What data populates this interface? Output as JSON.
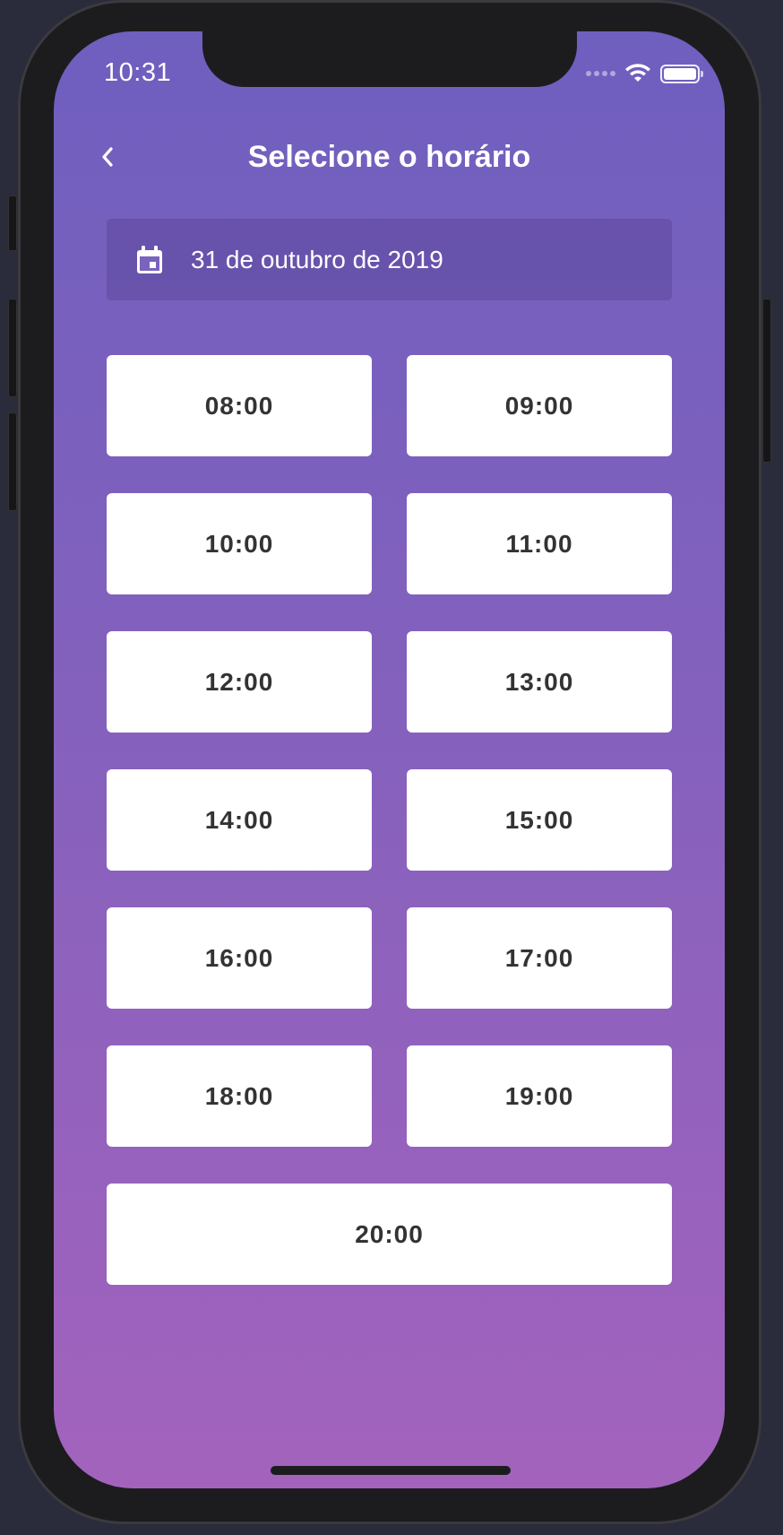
{
  "status_bar": {
    "time": "10:31"
  },
  "header": {
    "title": "Selecione o horário"
  },
  "date_selector": {
    "label": "31 de outubro de 2019"
  },
  "time_slots": [
    "08:00",
    "09:00",
    "10:00",
    "11:00",
    "12:00",
    "13:00",
    "14:00",
    "15:00",
    "16:00",
    "17:00",
    "18:00",
    "19:00",
    "20:00"
  ],
  "colors": {
    "gradient_top": "#6f5fbf",
    "gradient_bottom": "#a363bd",
    "slot_background": "#ffffff",
    "slot_text": "#333333"
  },
  "icons": {
    "back": "chevron-left-icon",
    "date": "calendar-icon",
    "wifi": "wifi-icon",
    "battery": "battery-icon"
  }
}
